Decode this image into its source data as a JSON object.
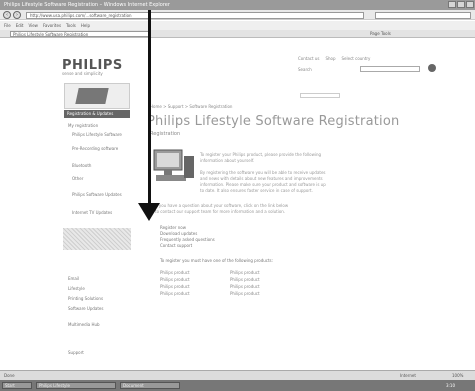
{
  "window": {
    "title": "Philips Lifestyle Software Registration – Windows Internet Explorer"
  },
  "browser": {
    "address": "http://www.usa.philips.com/...software_registration",
    "menu": [
      "File",
      "Edit",
      "View",
      "Favorites",
      "Tools",
      "Help"
    ],
    "tab_label": "Philips Lifestyle Software Registration",
    "tools_label": "Page  Tools"
  },
  "site": {
    "logo": "PHILIPS",
    "tagline": "sense and simplicity",
    "toplinks": [
      "Contact us",
      "Shop",
      "Select country"
    ],
    "search_label": "Search"
  },
  "sidebar": {
    "title": "Registration & Updates",
    "items": [
      "My registration",
      "Philips Lifestyle Software",
      "Pre-Recording software",
      "Bluetooth",
      "Other",
      "Philips Software Updates",
      "Internet TV Updates",
      "Email",
      "Lifestyle",
      "Printing Solutions",
      "Software Updates",
      "Multimedia Hub",
      "Support"
    ]
  },
  "breadcrumb": "Home > Support > Software Registration",
  "page": {
    "title": "Philips Lifestyle Software Registration",
    "subtitle": "Registration",
    "para1": [
      "To register your Philips product, please provide the following",
      "information about yourself."
    ],
    "para2": [
      "By registering the software you will be able to receive updates",
      "and news with details about new features and improvements",
      "information. Please make sure your product and software is up",
      "to date. It also ensures faster service in case of support."
    ],
    "para3": [
      "If you have a question about your software, click on the link below",
      "to contact our support team for more information and a solution."
    ],
    "links": [
      "Register now",
      "Download updates",
      "Frequently asked questions",
      "Contact support"
    ],
    "products_label": "To register you must have one of the following products:",
    "products": [
      [
        "Philips product",
        "Philips product"
      ],
      [
        "Philips product",
        "Philips product"
      ],
      [
        "Philips product",
        "Philips product"
      ],
      [
        "Philips product",
        "Philips product"
      ]
    ]
  },
  "status": {
    "left": "Done",
    "right": "Internet",
    "zoom": "100%"
  },
  "taskbar": {
    "items": [
      "Start",
      "Philips Lifestyle",
      "Document"
    ],
    "clock": "3:10"
  }
}
